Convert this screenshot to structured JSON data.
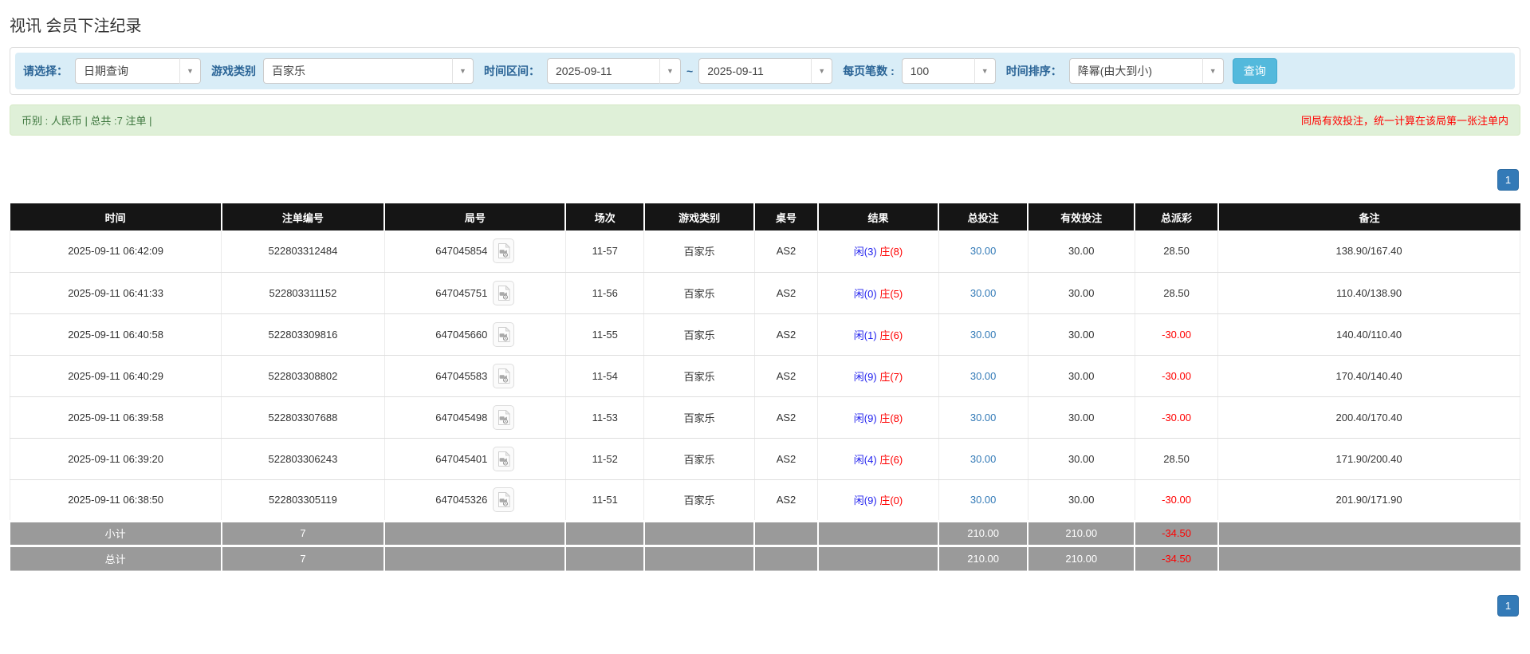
{
  "page": {
    "title": "视讯 会员下注纪录"
  },
  "filters": {
    "select_label": "请选择：",
    "select_value": "日期查询",
    "game_label": "游戏类别",
    "game_value": "百家乐",
    "range_label": "时间区间：",
    "date_from": "2025-09-11",
    "range_separator": "~",
    "date_to": "2025-09-11",
    "page_size_label": "每页笔数 :",
    "page_size_value": "100",
    "sort_label": "时间排序：",
    "sort_value": "降幂(由大到小)",
    "search_button": "查询"
  },
  "summary": {
    "left": "币别 : 人民币 | 总共 :7 注单 |",
    "right_note": "同局有效投注，统一计算在该局第一张注单内"
  },
  "pagination": {
    "page": "1"
  },
  "table": {
    "headers": [
      "时间",
      "注单编号",
      "局号",
      "场次",
      "游戏类别",
      "桌号",
      "结果",
      "总投注",
      "有效投注",
      "总派彩",
      "备注"
    ],
    "rows": [
      {
        "time": "2025-09-11 06:42:09",
        "bet_no": "522803312484",
        "round_no": "647045854",
        "session": "11-57",
        "game": "百家乐",
        "table_no": "AS2",
        "result_player": "闲(3)",
        "result_banker": "庄(8)",
        "total_bet": "30.00",
        "valid_bet": "30.00",
        "payout": "28.50",
        "remark": "138.90/167.40"
      },
      {
        "time": "2025-09-11 06:41:33",
        "bet_no": "522803311152",
        "round_no": "647045751",
        "session": "11-56",
        "game": "百家乐",
        "table_no": "AS2",
        "result_player": "闲(0)",
        "result_banker": "庄(5)",
        "total_bet": "30.00",
        "valid_bet": "30.00",
        "payout": "28.50",
        "remark": "110.40/138.90"
      },
      {
        "time": "2025-09-11 06:40:58",
        "bet_no": "522803309816",
        "round_no": "647045660",
        "session": "11-55",
        "game": "百家乐",
        "table_no": "AS2",
        "result_player": "闲(1)",
        "result_banker": "庄(6)",
        "total_bet": "30.00",
        "valid_bet": "30.00",
        "payout": "-30.00",
        "remark": "140.40/110.40"
      },
      {
        "time": "2025-09-11 06:40:29",
        "bet_no": "522803308802",
        "round_no": "647045583",
        "session": "11-54",
        "game": "百家乐",
        "table_no": "AS2",
        "result_player": "闲(9)",
        "result_banker": "庄(7)",
        "total_bet": "30.00",
        "valid_bet": "30.00",
        "payout": "-30.00",
        "remark": "170.40/140.40"
      },
      {
        "time": "2025-09-11 06:39:58",
        "bet_no": "522803307688",
        "round_no": "647045498",
        "session": "11-53",
        "game": "百家乐",
        "table_no": "AS2",
        "result_player": "闲(9)",
        "result_banker": "庄(8)",
        "total_bet": "30.00",
        "valid_bet": "30.00",
        "payout": "-30.00",
        "remark": "200.40/170.40"
      },
      {
        "time": "2025-09-11 06:39:20",
        "bet_no": "522803306243",
        "round_no": "647045401",
        "session": "11-52",
        "game": "百家乐",
        "table_no": "AS2",
        "result_player": "闲(4)",
        "result_banker": "庄(6)",
        "total_bet": "30.00",
        "valid_bet": "30.00",
        "payout": "28.50",
        "remark": "171.90/200.40"
      },
      {
        "time": "2025-09-11 06:38:50",
        "bet_no": "522803305119",
        "round_no": "647045326",
        "session": "11-51",
        "game": "百家乐",
        "table_no": "AS2",
        "result_player": "闲(9)",
        "result_banker": "庄(0)",
        "total_bet": "30.00",
        "valid_bet": "30.00",
        "payout": "-30.00",
        "remark": "201.90/171.90"
      }
    ],
    "subtotal": {
      "label": "小计",
      "count": "7",
      "total_bet": "210.00",
      "valid_bet": "210.00",
      "payout": "-34.50",
      "remark": ""
    },
    "total": {
      "label": "总计",
      "count": "7",
      "total_bet": "210.00",
      "valid_bet": "210.00",
      "payout": "-34.50",
      "remark": ""
    }
  },
  "icons": {
    "combo_arrow": "▼",
    "video_icon": "video-replay-icon"
  },
  "colors": {
    "filter_bar_bg": "#d9edf7",
    "filter_label": "#2a6496",
    "search_button_bg": "#53b9dc",
    "summary_bar_bg": "#dff0d8",
    "summary_text": "#3c763d",
    "warning_text": "#ff0000",
    "header_bg": "#151515",
    "subtotal_bg": "#9a9a9a",
    "link_blue": "#337ab7",
    "player_blue": "#2222ee",
    "banker_red": "#ff0000",
    "negative_red": "#ff0000",
    "pagination_bg": "#337ab7"
  }
}
